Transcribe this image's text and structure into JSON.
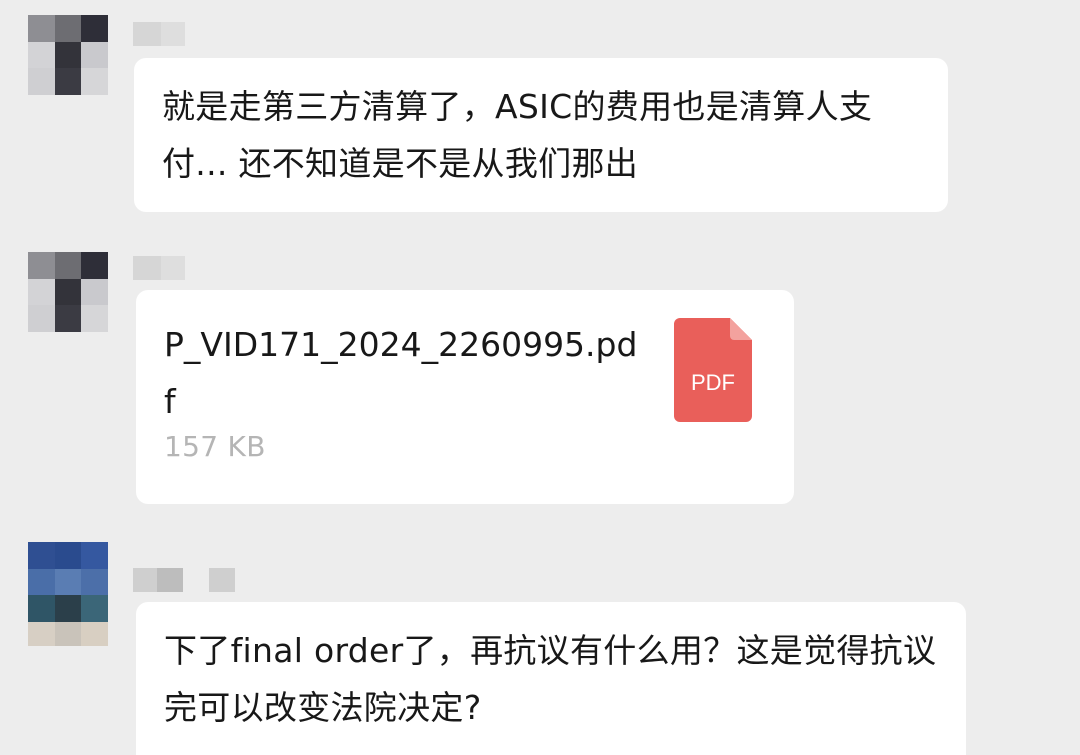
{
  "messages": [
    {
      "type": "text",
      "text": "就是走第三方清算了，ASIC的费用也是清算人支付... 还不知道是不是从我们那出"
    },
    {
      "type": "file",
      "file_name": "P_VID171_2024_2260995.pdf",
      "file_size": "157 KB",
      "file_type_label": "PDF",
      "icon": "pdf-file-icon",
      "icon_color": "#e95f5a"
    },
    {
      "type": "text",
      "text": "下了final order了，再抗议有什么用？这是觉得抗议完可以改变法院决定?"
    }
  ],
  "colors": {
    "background": "#ededed",
    "bubble": "#ffffff",
    "text": "#181818",
    "secondary_text": "#b5b5b5",
    "pdf_icon": "#e95f5a"
  }
}
